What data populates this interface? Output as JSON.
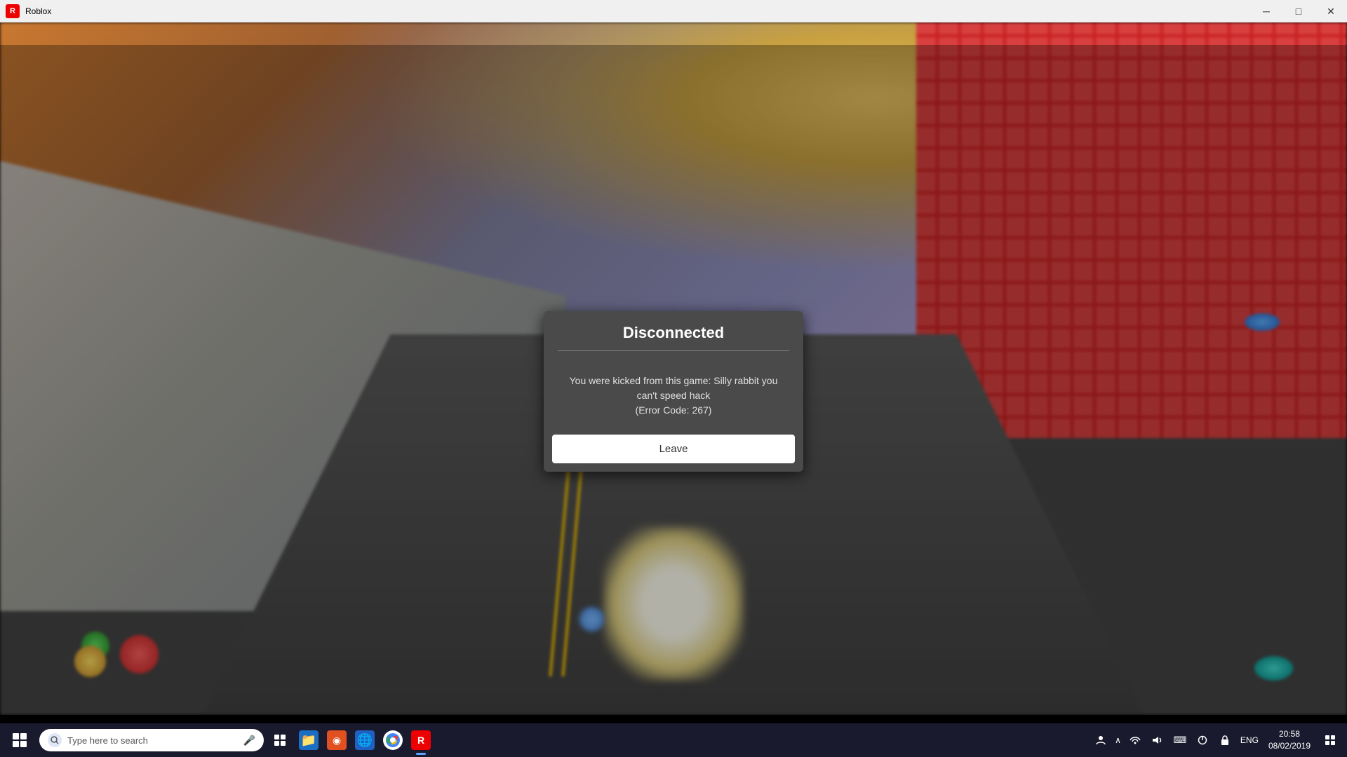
{
  "titlebar": {
    "title": "Roblox",
    "icon_label": "R"
  },
  "dialog": {
    "title": "Disconnected",
    "divider": true,
    "message": "You were kicked from this game: Silly rabbit you can't speed hack\n(Error Code: 267)",
    "leave_button": "Leave"
  },
  "taskbar": {
    "search_placeholder": "Type here to search",
    "clock_time": "20:58",
    "clock_date": "08/02/2019",
    "lang": "ENG",
    "taskbar_icons": [
      {
        "name": "file-explorer",
        "emoji": "📁",
        "active": false
      },
      {
        "name": "roblox-studio",
        "emoji": "🟥",
        "active": false,
        "active_color": "#e00"
      },
      {
        "name": "browser-chrome",
        "emoji": "🌐",
        "active": false
      },
      {
        "name": "roblox",
        "emoji": "🎮",
        "active": true
      }
    ],
    "tray_icons": [
      "👤",
      "🔼",
      "📶",
      "🔊",
      "⌨️",
      "🔌",
      "🔒"
    ]
  },
  "icons": {
    "minimize": "─",
    "maximize": "□",
    "close": "✕",
    "start": "⊞",
    "search": "🔍",
    "mic": "🎤",
    "task_view": "⧉",
    "notification": "💬",
    "chevron": "∧"
  }
}
